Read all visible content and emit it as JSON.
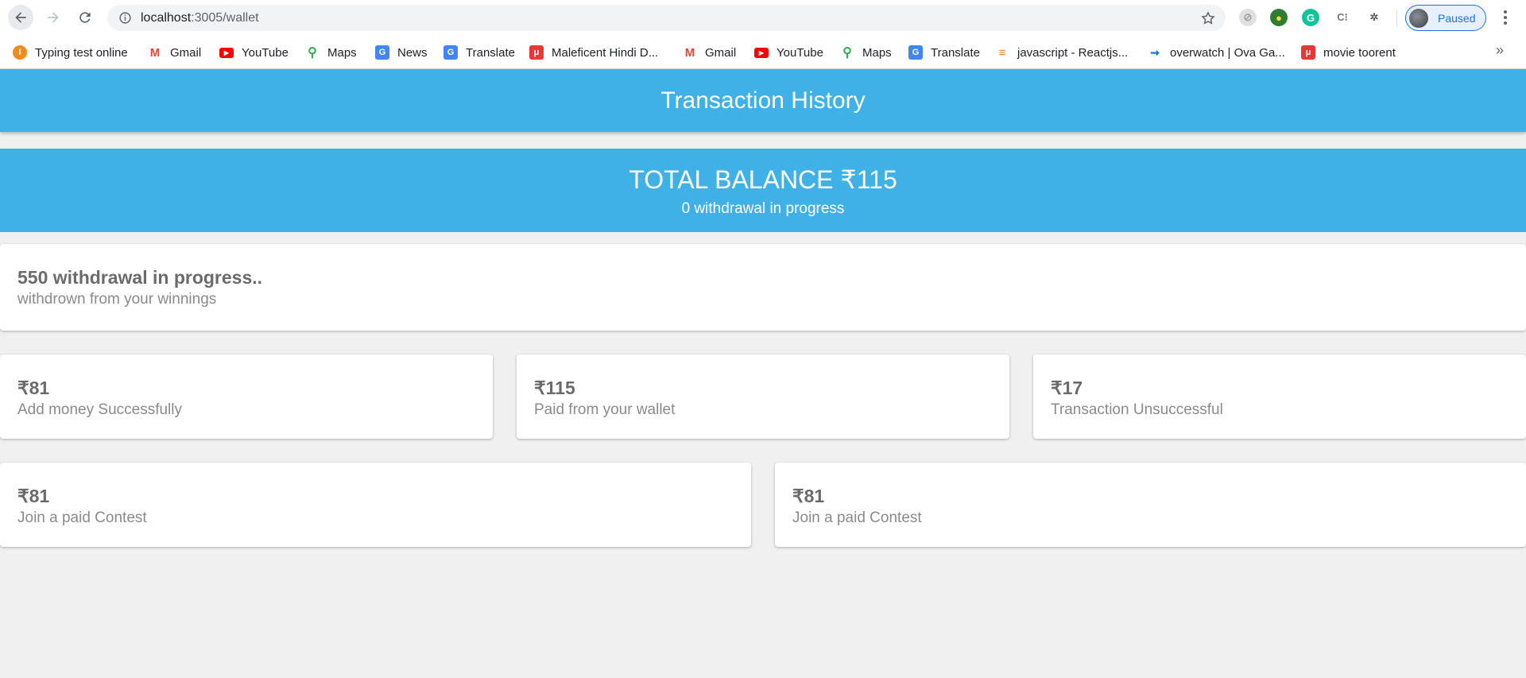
{
  "browser": {
    "url_host": "localhost",
    "url_path": ":3005/wallet",
    "profile_label": "Paused",
    "bookmarks": [
      {
        "label": "Typing test online",
        "icon": "typing-icon",
        "color": "#f28b1e"
      },
      {
        "label": "Gmail",
        "icon": "gmail-icon",
        "color": "#ea4335"
      },
      {
        "label": "YouTube",
        "icon": "youtube-icon",
        "color": "#ff0000"
      },
      {
        "label": "Maps",
        "icon": "maps-icon",
        "color": "#34a853"
      },
      {
        "label": "News",
        "icon": "news-icon",
        "color": "#4285f4"
      },
      {
        "label": "Translate",
        "icon": "translate-icon",
        "color": "#4285f4"
      },
      {
        "label": "Maleficent Hindi D...",
        "icon": "torrent-icon",
        "color": "#e53935"
      },
      {
        "label": "Gmail",
        "icon": "gmail-icon",
        "color": "#ea4335"
      },
      {
        "label": "YouTube",
        "icon": "youtube-icon",
        "color": "#ff0000"
      },
      {
        "label": "Maps",
        "icon": "maps-icon",
        "color": "#34a853"
      },
      {
        "label": "Translate",
        "icon": "translate-icon",
        "color": "#4285f4"
      },
      {
        "label": "javascript - Reactjs...",
        "icon": "stackoverflow-icon",
        "color": "#f48024"
      },
      {
        "label": "overwatch | Ova Ga...",
        "icon": "ova-icon",
        "color": "#1976d2"
      },
      {
        "label": "movie toorent",
        "icon": "torrent-icon",
        "color": "#e53935"
      }
    ],
    "more_label": "»"
  },
  "header": {
    "title": "Transaction History"
  },
  "balance": {
    "total": "TOTAL BALANCE ₹115",
    "pending": "0 withdrawal in progress"
  },
  "withdraw_card": {
    "amount": "550 withdrawal in progress..",
    "desc": "withdrown from your winnings"
  },
  "transactions": [
    {
      "amount": "₹81",
      "desc": "Add money Successfully"
    },
    {
      "amount": "₹115",
      "desc": "Paid from your wallet"
    },
    {
      "amount": "₹17",
      "desc": "Transaction Unsuccessful"
    },
    {
      "amount": "₹81",
      "desc": "Join a paid Contest"
    },
    {
      "amount": "₹81",
      "desc": "Join a paid Contest"
    }
  ],
  "colors": {
    "accent": "#3fb1e6",
    "background": "#f0f0f0",
    "card": "#ffffff"
  }
}
